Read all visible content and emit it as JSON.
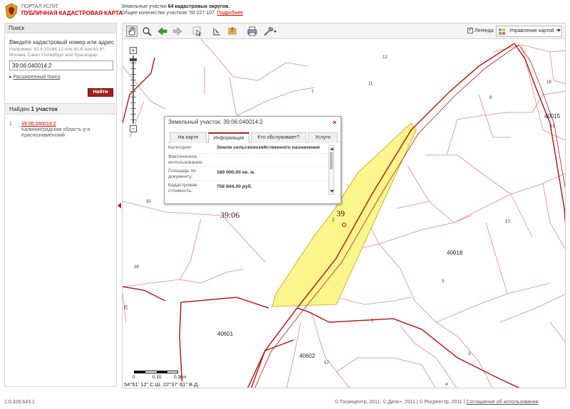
{
  "header": {
    "portal": "ПОРТАЛ УСЛУГ",
    "title": "ПУБЛИЧНАЯ КАДАСТРОВАЯ КАРТА",
    "stats_prefix": "Земельные участки ",
    "stats_districts": "64 кадастровых округов.",
    "stats_total_prefix": "Общее количество участков: ",
    "stats_total": "50 227 107",
    "more": "Подробнее"
  },
  "search": {
    "panel_title": "Поиск",
    "label": "Введите кадастровый номер или адрес",
    "hint": "Например: 61:6:10164:12 или 61:6 или 61:6*, Москва, Санкт-Петербург или Краснодар",
    "value": "39:06:040014:2",
    "advanced": "Расширенный поиск",
    "button": "Найти"
  },
  "results": {
    "heading_prefix": "Найден ",
    "heading_count": "1 участок",
    "items": [
      {
        "num": "1",
        "id": "39:06:040014:2",
        "address": "Калининградская область р-н Краснознаменский"
      }
    ]
  },
  "toolbar": {
    "legend": "Легенда",
    "map_management": "Управление картой"
  },
  "popup": {
    "title": "Земельный участок: 39:06:040014:2",
    "tabs": [
      "На карте",
      "Информация",
      "Кто обслуживает?",
      "Услуги"
    ],
    "active_tab": "Информация",
    "rows": [
      {
        "key": "Категория:",
        "value": "Земли сельскохозяйственного назначения"
      },
      {
        "key": "Фактическое использование:",
        "value": ""
      },
      {
        "key": "Площадь по документу:",
        "value": "180 000.00 кв. м."
      },
      {
        "key": "Кадастровая стоимость:",
        "value": "758 844.00 руб."
      }
    ]
  },
  "map": {
    "labels": [
      "12",
      "11",
      "7",
      "9",
      "18",
      "40015",
      "19",
      "30",
      "39:06",
      "39",
      "2",
      "10",
      "40018",
      "29",
      "5",
      "7",
      "40601",
      "40602",
      "57",
      "3",
      "4",
      "29"
    ],
    "scale": [
      "0",
      "0.15",
      "0.3km"
    ],
    "coords": "54°51' 12\" С.Ш.  22°37' 61\" В.Д.",
    "colors": {
      "parcel_fill": "#fbf58c",
      "boundary": "#b02020",
      "grid": "#d89090"
    }
  },
  "footer": {
    "version": "2.0.328.643.1",
    "copyright": "© Госинцентр, 2011, © Дата+, 2011 | © Росреестр, 2011 | ",
    "agreement": "Соглашение об использовании"
  }
}
